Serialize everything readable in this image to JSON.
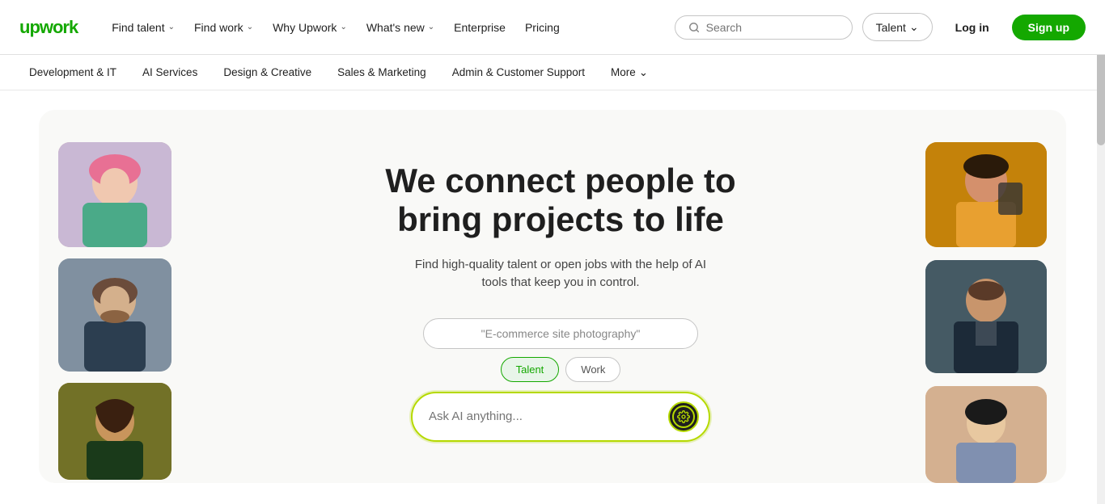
{
  "logo": "upwork",
  "nav": {
    "find_talent": "Find talent",
    "find_work": "Find work",
    "why_upwork": "Why Upwork",
    "whats_new": "What's new",
    "enterprise": "Enterprise",
    "pricing": "Pricing",
    "search_placeholder": "Search",
    "talent_dropdown": "Talent",
    "login": "Log in",
    "signup": "Sign up"
  },
  "secondary_nav": {
    "items": [
      "Development & IT",
      "AI Services",
      "Design & Creative",
      "Sales & Marketing",
      "Admin & Customer Support",
      "More"
    ]
  },
  "hero": {
    "title": "We connect people to bring projects to life",
    "subtitle": "Find high-quality talent or open jobs with the help of AI tools that keep you in control.",
    "search_example": "\"E-commerce site photography\"",
    "filter1": "Talent",
    "filter2": "Work",
    "ai_placeholder": "Ask AI anything...",
    "ai_icon_label": "ai-submit"
  }
}
